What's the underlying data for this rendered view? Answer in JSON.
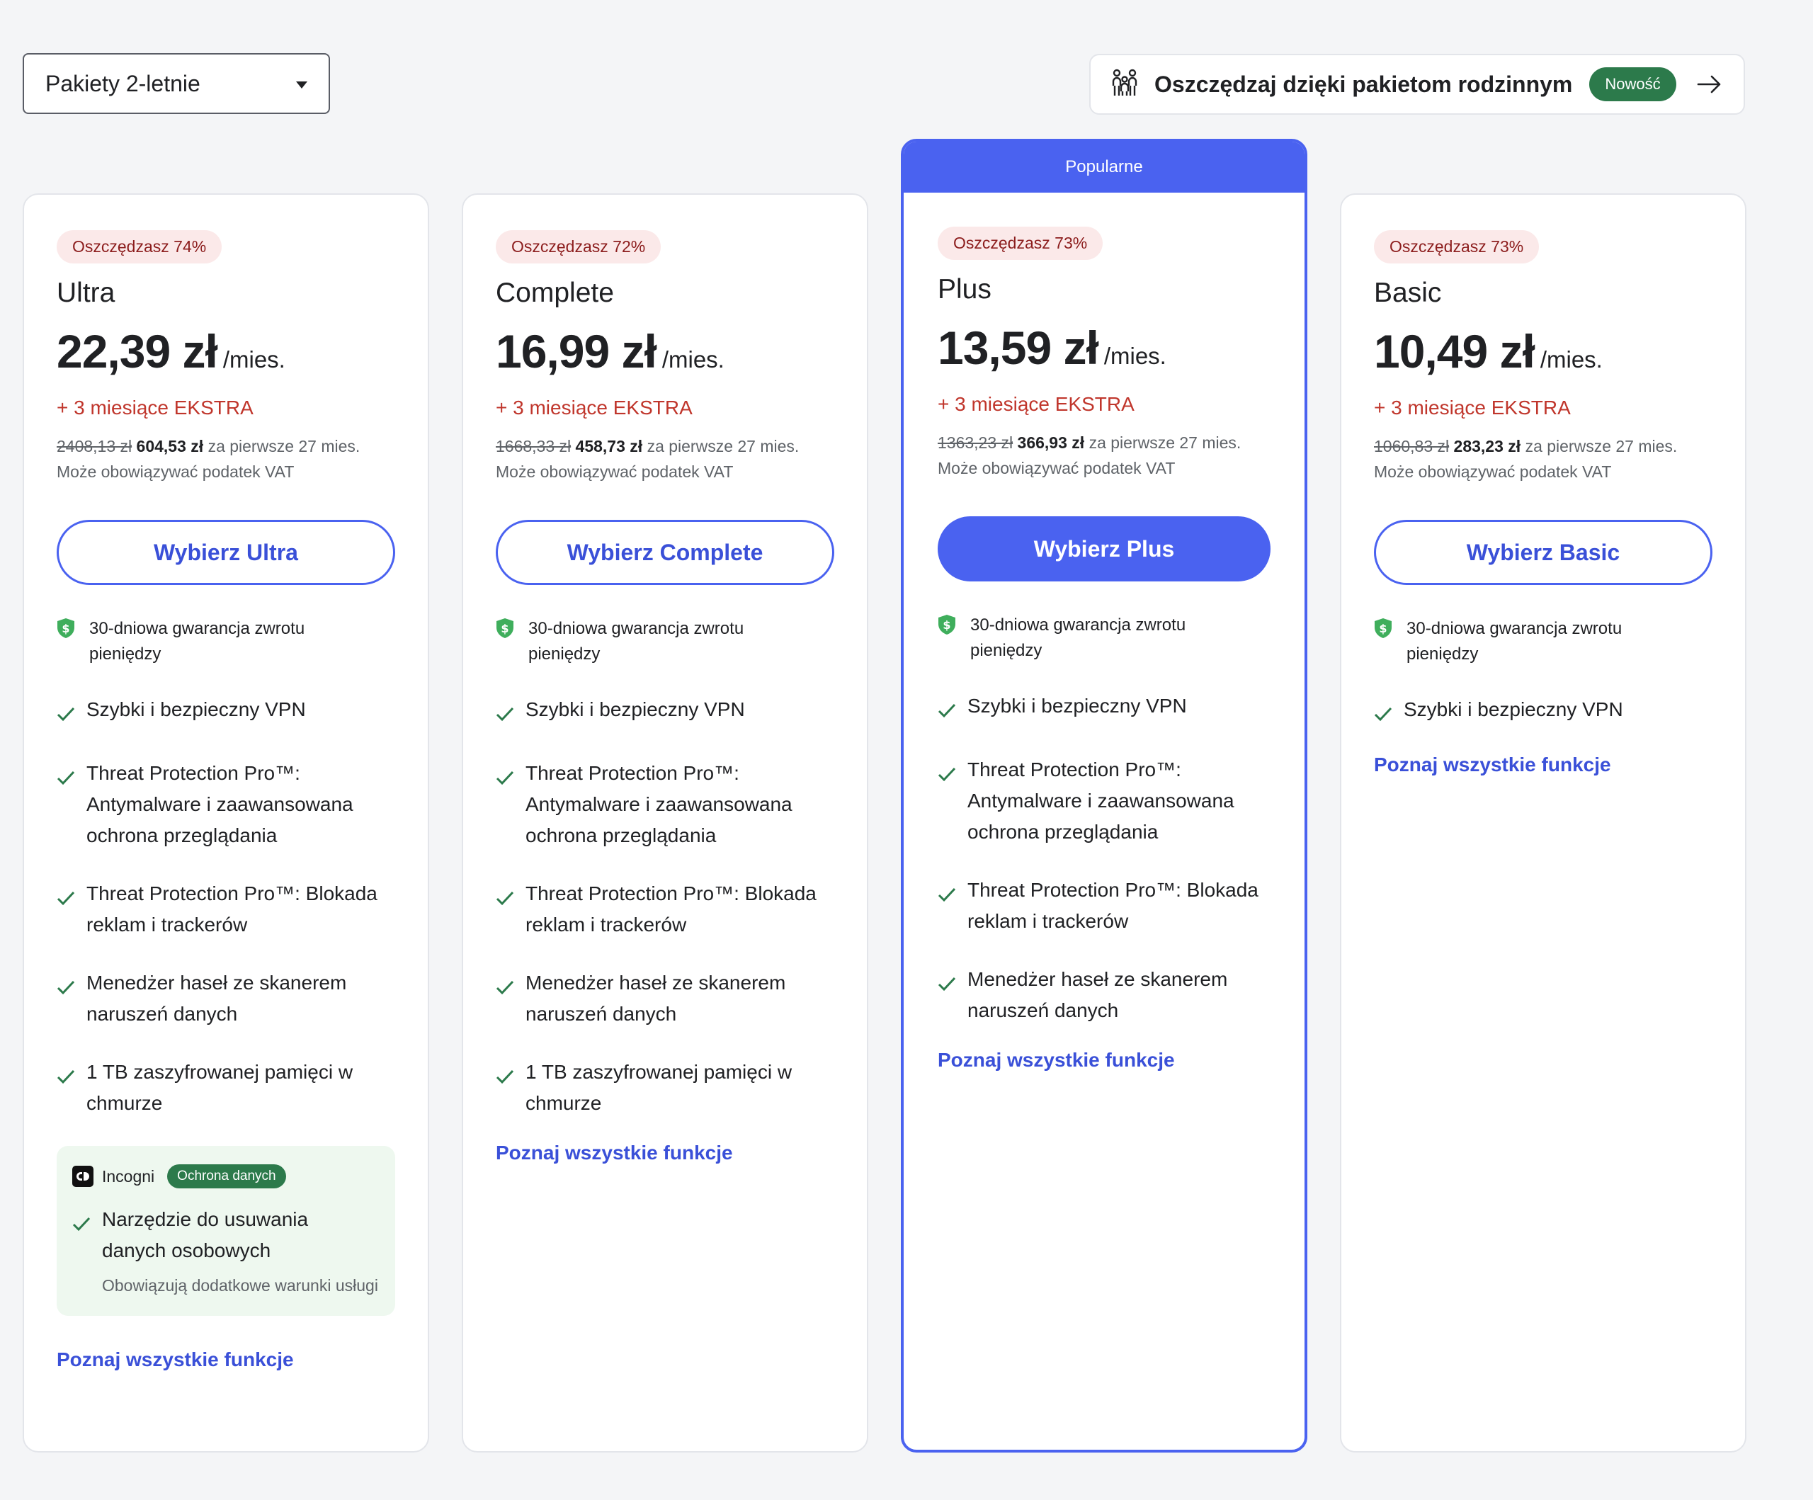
{
  "plan_selector": {
    "value": "Pakiety 2-letnie"
  },
  "family_banner": {
    "text": "Oszczędzaj dzięki pakietom rodzinnym",
    "badge": "Nowość"
  },
  "popular_label": "Popularne",
  "common": {
    "per_label": "/mies.",
    "extra": "+ 3 miesiące EKSTRA",
    "first_period": "za pierwsze 27 mies.",
    "vat_note": "Może obowiązywać podatek VAT",
    "guarantee": "30-dniowa gwarancja zwrotu pieniędzy",
    "more_link": "Poznaj wszystkie funkcje"
  },
  "features": {
    "vpn": "Szybki i bezpieczny VPN",
    "tp_antimalware": "Threat Protection Pro™: Antymalware i zaawansowana ochrona przeglądania",
    "tp_ads": "Threat Protection Pro™: Blokada reklam i trackerów",
    "passwords": "Menedżer haseł ze skanerem naruszeń danych",
    "cloud": "1 TB zaszyfrowanej pamięci w chmurze"
  },
  "incogni": {
    "name": "Incogni",
    "badge": "Ochrona danych",
    "feature": "Narzędzie do usuwania danych osobowych",
    "note": "Obowiązują dodatkowe warunki usługi"
  },
  "plans": [
    {
      "name": "Ultra",
      "save": "Oszczędzasz 74%",
      "price": "22,39 zł",
      "old_total": "2408,13 zł",
      "new_total": "604,53 zł",
      "cta": "Wybierz Ultra"
    },
    {
      "name": "Complete",
      "save": "Oszczędzasz 72%",
      "price": "16,99 zł",
      "old_total": "1668,33 zł",
      "new_total": "458,73 zł",
      "cta": "Wybierz Complete"
    },
    {
      "name": "Plus",
      "save": "Oszczędzasz 73%",
      "price": "13,59 zł",
      "old_total": "1363,23 zł",
      "new_total": "366,93 zł",
      "cta": "Wybierz Plus"
    },
    {
      "name": "Basic",
      "save": "Oszczędzasz 73%",
      "price": "10,49 zł",
      "old_total": "1060,83 zł",
      "new_total": "283,23 zł",
      "cta": "Wybierz Basic"
    }
  ],
  "colors": {
    "accent": "#4a62f0",
    "save_text": "#8c1d1d",
    "extra_text": "#c0362c",
    "success": "#2c7a4b",
    "check": "#2c7a4b"
  }
}
